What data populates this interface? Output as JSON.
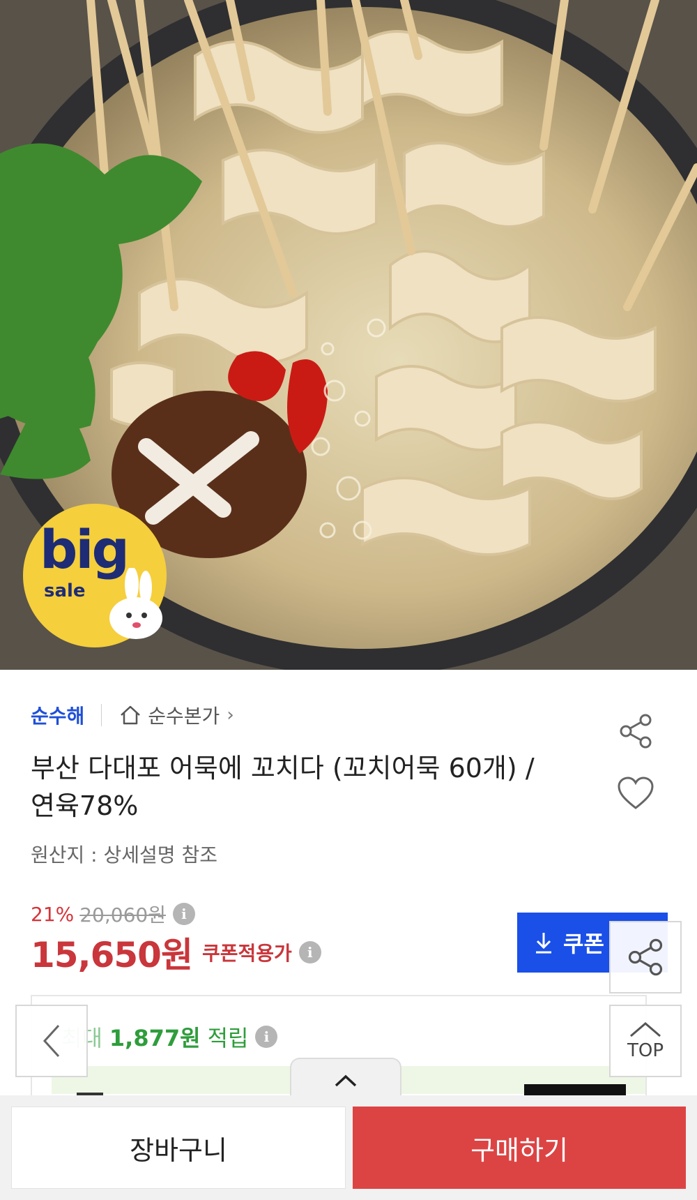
{
  "hero": {
    "badge": {
      "big": "big",
      "sale": "sale"
    }
  },
  "product": {
    "brand": "순수해",
    "store": "순수본가",
    "title_line1": "부산 다대포 어묵에 꼬치다 (꼬치어묵 60개) /",
    "title_line2": "연육78%",
    "origin": "원산지 : 상세설명 참조"
  },
  "price": {
    "discount": "21%",
    "original": "20,060원",
    "sale": "15,650원",
    "coupon_applied": "쿠폰적용가"
  },
  "coupon_button": {
    "label": "쿠폰"
  },
  "points": {
    "label": "최대",
    "value": "1,877원",
    "unit": "적립"
  },
  "floating": {
    "top_label": "TOP"
  },
  "bottom_bar": {
    "cart": "장바구니",
    "buy": "구매하기"
  },
  "colors": {
    "brand_blue": "#1f4fd8",
    "price_red": "#c9363b",
    "coupon_blue": "#1a4fe8",
    "points_green": "#2e9d3b",
    "buy_red": "#dc4444",
    "badge_yellow": "#f5cf3c"
  },
  "icons": [
    "home-icon",
    "chevron-right-icon",
    "share-icon",
    "heart-icon",
    "info-icon",
    "download-icon",
    "chevron-left-icon",
    "chevron-up-icon"
  ]
}
